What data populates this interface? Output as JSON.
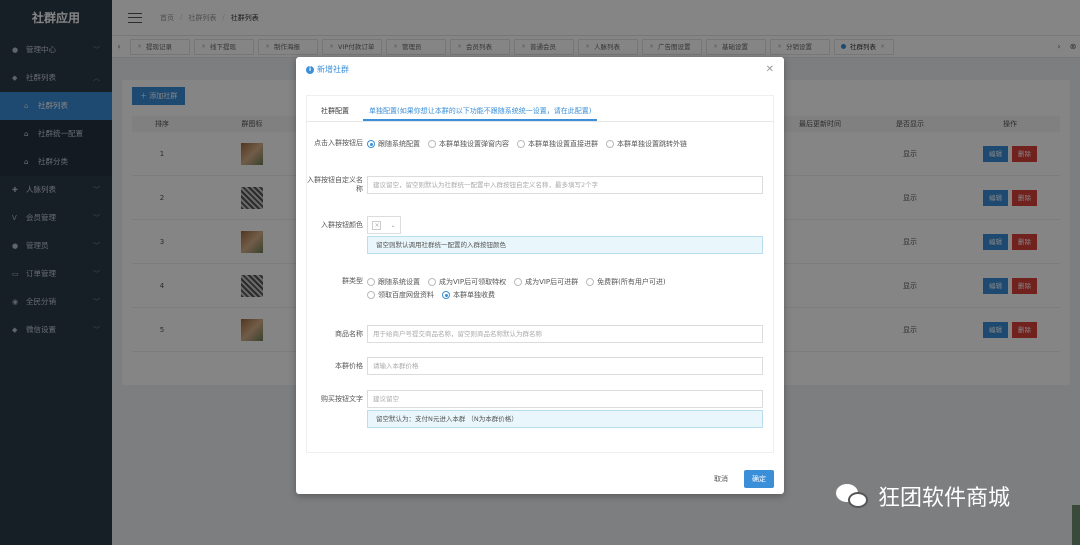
{
  "app_title": "社群应用",
  "sidebar": {
    "items": [
      {
        "label": "管理中心",
        "icon": "gauge-icon",
        "glyph": "●",
        "chev": "﹀"
      },
      {
        "label": "社群列表",
        "icon": "chat-icon",
        "glyph": "◆",
        "chev": "︿"
      },
      {
        "label": "社群列表",
        "icon": "home-icon",
        "glyph": "⌂",
        "sub": true,
        "active": true
      },
      {
        "label": "社群统一配置",
        "icon": "home-icon",
        "glyph": "⌂",
        "sub": true
      },
      {
        "label": "社群分类",
        "icon": "home-icon",
        "glyph": "⌂",
        "sub": true
      },
      {
        "label": "人脉列表",
        "icon": "person-icon",
        "glyph": "✚",
        "chev": "﹀"
      },
      {
        "label": "会员管理",
        "icon": "vip-icon",
        "glyph": "V",
        "chev": "﹀"
      },
      {
        "label": "管理员",
        "icon": "user-icon",
        "glyph": "●",
        "chev": "﹀"
      },
      {
        "label": "订单管理",
        "icon": "order-icon",
        "glyph": "▭",
        "chev": "﹀"
      },
      {
        "label": "全民分销",
        "icon": "share-icon",
        "glyph": "◉",
        "chev": "﹀"
      },
      {
        "label": "微信设置",
        "icon": "wechat-icon",
        "glyph": "◆",
        "chev": "﹀"
      }
    ]
  },
  "header": {
    "breadcrumbs": [
      "首页",
      "社群列表",
      "社群列表"
    ]
  },
  "tabs": [
    "提现记录",
    "线下提现",
    "制作海报",
    "VIP付款订单",
    "管理员",
    "会员列表",
    "普通会员",
    "人脉列表",
    "广告图设置",
    "基础设置",
    "分销设置",
    "社群列表"
  ],
  "toolbar": {
    "add_label": "添加社群"
  },
  "table": {
    "headers": {
      "no": "排序",
      "qr": "群图标",
      "time": "最后更新时间",
      "show": "是否显示",
      "op": "操作"
    },
    "rows": [
      {
        "no": "1",
        "show": "显示",
        "qr": "photo"
      },
      {
        "no": "2",
        "show": "显示",
        "qr": "code"
      },
      {
        "no": "3",
        "show": "显示",
        "qr": "photo"
      },
      {
        "no": "4",
        "show": "显示",
        "qr": "code"
      },
      {
        "no": "5",
        "show": "显示",
        "qr": "photo"
      }
    ],
    "edit_label": "编辑",
    "delete_label": "删除"
  },
  "modal": {
    "title": "新增社群",
    "tabs": [
      "社群配置",
      "单独配置(如果你想让本群的以下功能不跟随系统统一设置，请在此配置)"
    ],
    "join_button": {
      "label": "点击入群按钮后",
      "options": [
        "跟随系统配置",
        "本群单独设置弹窗内容",
        "本群单独设置直接进群",
        "本群单独设置跳转外链"
      ]
    },
    "join_name": {
      "label": "入群按钮自定义名称",
      "placeholder": "建议留空，留空则默认为社群统一配置中入群按钮自定义名称，最多填写2个字"
    },
    "join_color": {
      "label": "入群按钮颜色",
      "hint": "留空则默认调用社群统一配置的入群按钮颜色"
    },
    "group_type": {
      "label": "群类型",
      "options": [
        "跟随系统设置",
        "成为VIP后可领取特权",
        "成为VIP后可进群",
        "免费群(所有用户可进)",
        "领取百度网盘资料",
        "本群单独收费"
      ]
    },
    "product_name": {
      "label": "商品名称",
      "placeholder": "用于给商户号提交商品名称，留空则商品名称默认为群名称"
    },
    "price": {
      "label": "本群价格",
      "placeholder": "请输入本群价格"
    },
    "buy_text": {
      "label": "购买按钮文字",
      "placeholder": "建议留空",
      "hint": "留空默认为：支付N元进入本群 （N为本群价格）"
    },
    "cancel_label": "取消",
    "ok_label": "确定"
  },
  "watermark": {
    "text": "狂团软件商城"
  },
  "colors": {
    "primary": "#3b8fd9",
    "danger": "#d9403b",
    "sidebar": "#2b3a4a"
  }
}
